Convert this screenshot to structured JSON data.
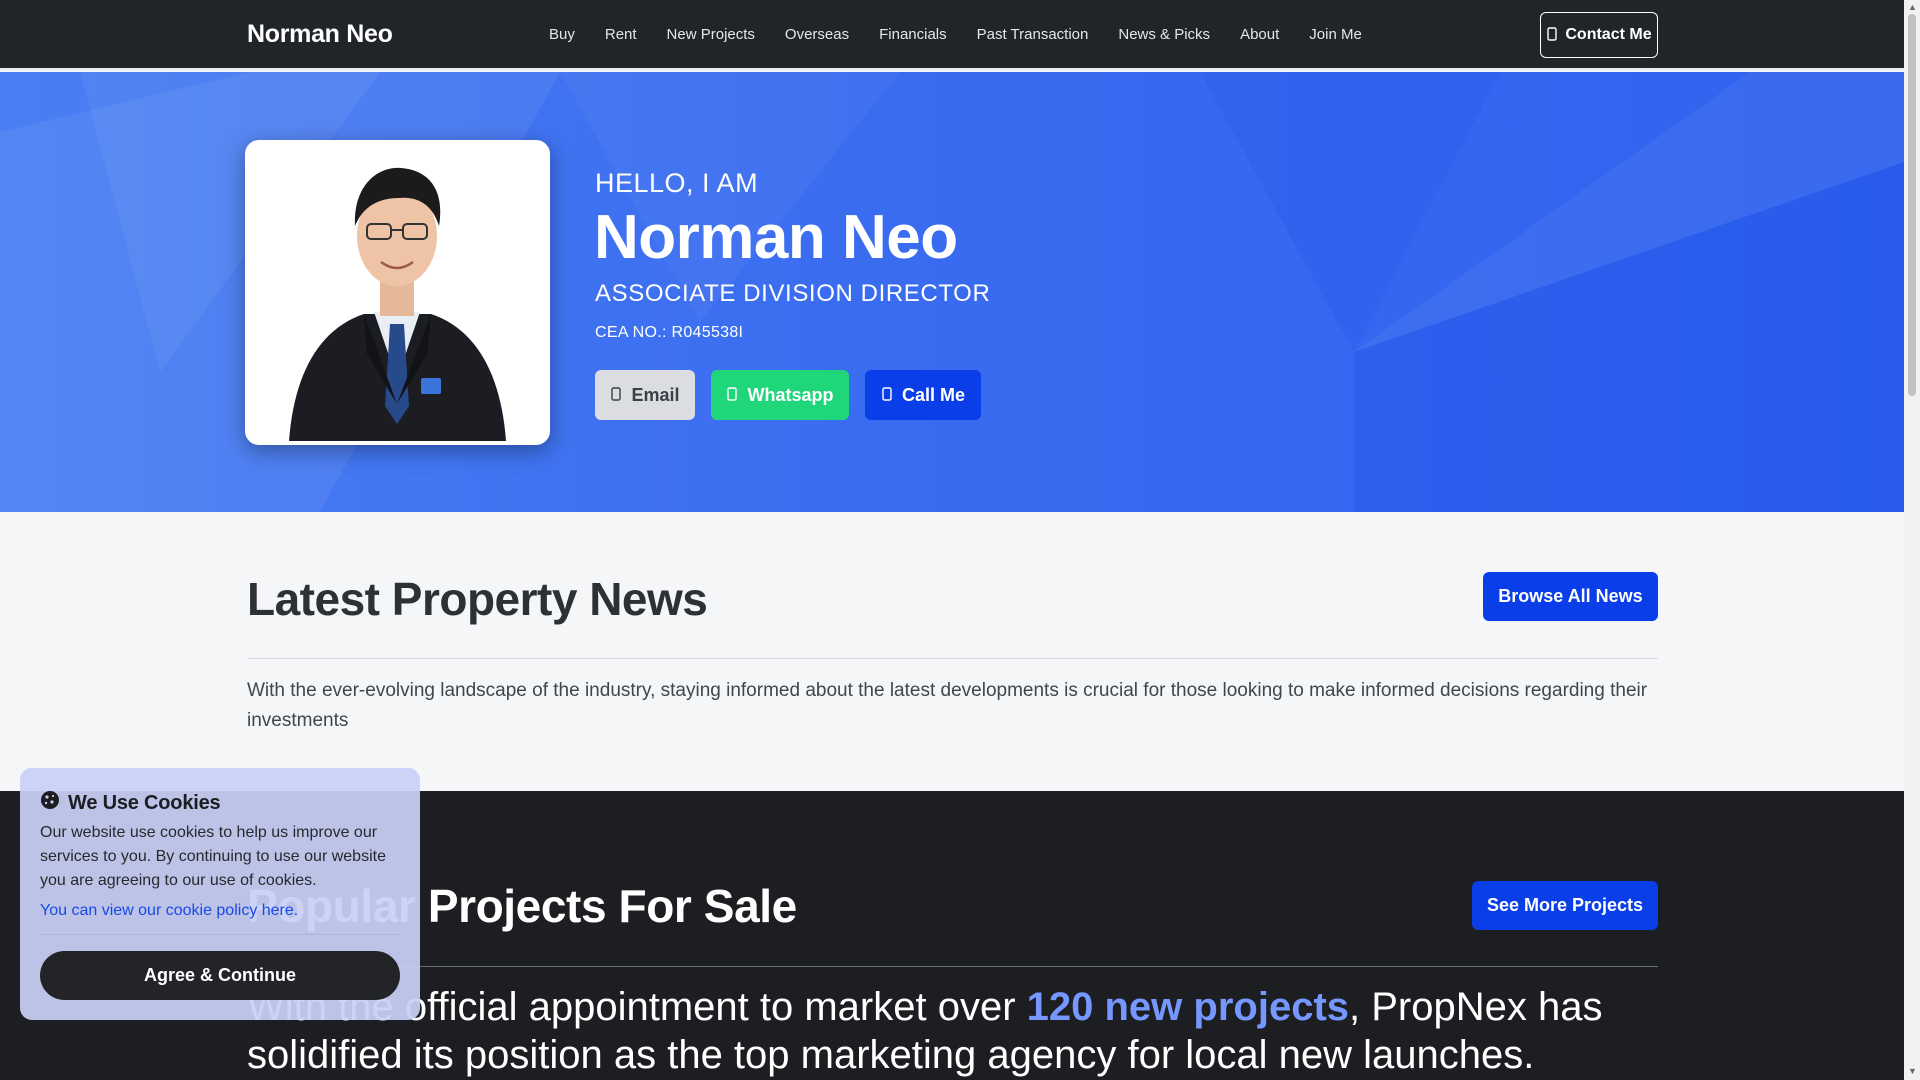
{
  "navbar": {
    "brand": "Norman Neo",
    "links": [
      "Buy",
      "Rent",
      "New Projects",
      "Overseas",
      "Financials",
      "Past Transaction",
      "News & Picks",
      "About",
      "Join Me"
    ],
    "contact_label": "Contact Me"
  },
  "hero": {
    "greeting": "HELLO, I AM",
    "name": "Norman Neo",
    "title": "ASSOCIATE DIVISION DIRECTOR",
    "cea": "CEA NO.: R045538I",
    "buttons": {
      "email": "Email",
      "whatsapp": "Whatsapp",
      "call": "Call Me"
    },
    "colors": {
      "background": "#3a6cf0",
      "whatsapp": "#1fd77a",
      "call": "#0a3ee8"
    }
  },
  "news": {
    "heading": "Latest Property News",
    "browse_label": "Browse All News",
    "description": "With the ever-evolving landscape of the industry, staying informed about the latest developments is crucial for those looking to make informed decisions regarding their investments"
  },
  "projects": {
    "heading": "Popular Projects For Sale",
    "more_label": "See More Projects",
    "lead_before": "With the official appointment to market over ",
    "lead_highlight": "120 new projects",
    "lead_after": ", PropNex has solidified its position as the top marketing agency for local new launches."
  },
  "cookie": {
    "title": "We Use Cookies",
    "text": "Our website use cookies to help us improve our services to you. By continuing to use our website you are agreeing to our use of cookies.",
    "policy_link": "You can view our cookie policy here.",
    "agree_label": "Agree & Continue"
  },
  "icons": {
    "contact": "phone-icon",
    "email": "envelope-icon",
    "whatsapp": "whatsapp-icon",
    "call": "phone-icon",
    "cookie": "cookie-icon"
  }
}
